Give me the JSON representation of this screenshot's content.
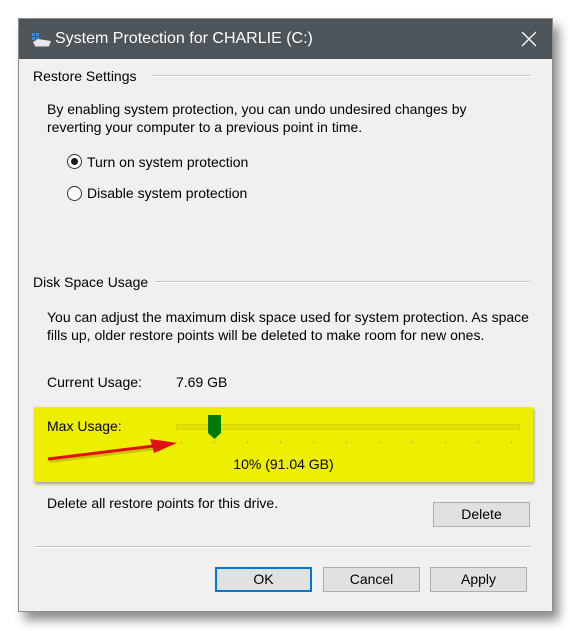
{
  "window": {
    "title": "System Protection for CHARLIE (C:)",
    "icon": "drive-protection-icon",
    "close_icon": "close-icon"
  },
  "restore_settings": {
    "label": "Restore Settings",
    "description_line1": "By enabling system protection, you can undo undesired changes by",
    "description_line2": "reverting your computer to a previous point in time.",
    "options": [
      {
        "label": "Turn on system protection",
        "checked": true
      },
      {
        "label": "Disable system protection",
        "checked": false
      }
    ]
  },
  "disk_space_usage": {
    "label": "Disk Space Usage",
    "description_line1": "You can adjust the maximum disk space used for system protection. As space",
    "description_line2": "fills up, older restore points will be deleted to make room for new ones.",
    "current_usage_label": "Current Usage:",
    "current_usage_value": "7.69 GB",
    "max_usage_label": "Max Usage:",
    "max_usage_percent": 10,
    "max_usage_readout": "10% (91.04 GB)",
    "highlight_color": "#eeee00",
    "thumb_color": "#007a00",
    "arrow_color": "#e01010"
  },
  "delete": {
    "text": "Delete all restore points for this drive.",
    "button_label": "Delete"
  },
  "footer": {
    "ok_label": "OK",
    "cancel_label": "Cancel",
    "apply_label": "Apply"
  }
}
